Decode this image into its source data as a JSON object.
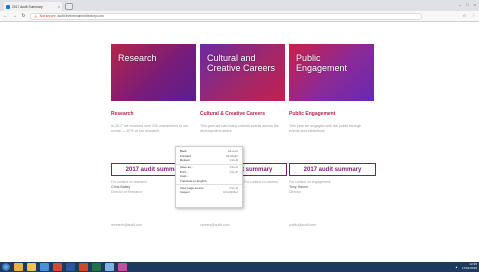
{
  "browser": {
    "tab_title": "2017 Audit Summary",
    "tab_close": "×",
    "new_tab_label": "",
    "window_controls": [
      "–",
      "□",
      "×"
    ],
    "back": "←",
    "forward": "→",
    "reload": "↻",
    "warning_icon": "⚠",
    "not_secure": "Not secure",
    "url": "audit.theforenamedirectory.com",
    "star": "☆",
    "menu": "⋮"
  },
  "cards": [
    {
      "image_title": "Research",
      "heading": "Research",
      "description": "In 2017 we received over 200 researchers to our centre — 87% of our research.",
      "button": "2017 audit summary",
      "contact_label": "For contact on research",
      "contact_name": "Chris Bailey",
      "contact_role": "Director of Research",
      "email": "research@audit.com"
    },
    {
      "image_title": "Cultural and Creative Careers",
      "heading": "Cultural & Creative Careers",
      "description": "This year we had many cultural events across the development centre.",
      "button": "2017 audit summary",
      "contact_label": "For contact on careers",
      "contact_name": "",
      "contact_role": "",
      "email": "careers@audit.com"
    },
    {
      "image_title": "Public Engagement",
      "heading": "Public Engagement",
      "description": "This year we engaged with the public through events and exhibitions.",
      "button": "2017 audit summary",
      "contact_label": "For contact on engagement",
      "contact_name": "Tony Hanne",
      "contact_role": "Director",
      "email": "public@audit.com"
    }
  ],
  "context_menu": {
    "items": [
      {
        "label": "Back",
        "shortcut": "Alt+Left"
      },
      {
        "label": "Forward",
        "shortcut": "Alt+Right"
      },
      {
        "label": "Reload",
        "shortcut": "Ctrl+R"
      },
      {
        "label": "Save as...",
        "shortcut": "Ctrl+S"
      },
      {
        "label": "Print...",
        "shortcut": "Ctrl+P"
      },
      {
        "label": "Cast...",
        "shortcut": ""
      },
      {
        "label": "Translate to English",
        "shortcut": ""
      },
      {
        "label": "View page source",
        "shortcut": "Ctrl+U"
      },
      {
        "label": "Inspect",
        "shortcut": "Ctrl+Shift+I"
      }
    ]
  },
  "taskbar": {
    "apps": [
      {
        "name": "browser",
        "color": "#e8b33c"
      },
      {
        "name": "folder",
        "color": "#f2c14e"
      },
      {
        "name": "media",
        "color": "#4a90d9"
      },
      {
        "name": "chrome",
        "color": "#db4437"
      },
      {
        "name": "word",
        "color": "#2b579a"
      },
      {
        "name": "powerpoint",
        "color": "#d24726"
      },
      {
        "name": "excel",
        "color": "#217346"
      },
      {
        "name": "explorer",
        "color": "#7fb2e5"
      },
      {
        "name": "paint",
        "color": "#c74fa0"
      }
    ],
    "time": "12:45",
    "date": "17/01/2018"
  },
  "colors": {
    "accent": "#7a1c78",
    "heading": "#b2254f"
  }
}
